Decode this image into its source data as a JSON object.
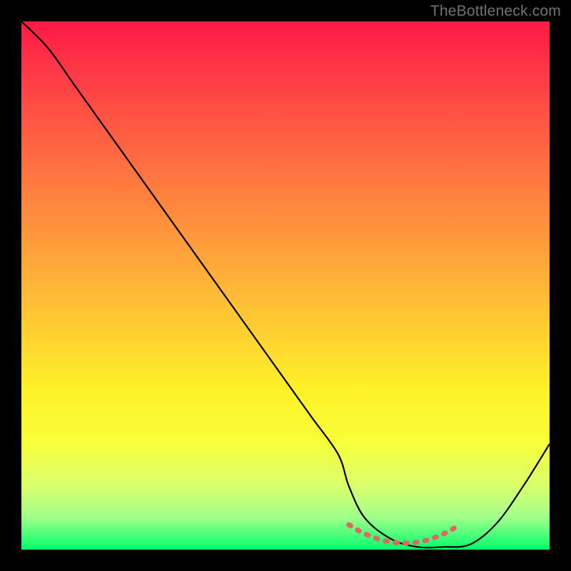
{
  "watermark": "TheBottleneck.com",
  "chart_data": {
    "type": "line",
    "title": "",
    "xlabel": "",
    "ylabel": "",
    "xlim": [
      0,
      100
    ],
    "ylim": [
      0,
      100
    ],
    "x": [
      0,
      5,
      10,
      15,
      20,
      25,
      30,
      35,
      40,
      45,
      50,
      55,
      60,
      62,
      65,
      70,
      75,
      80,
      85,
      90,
      95,
      100
    ],
    "values": [
      100,
      95,
      88,
      81,
      74,
      67,
      60,
      53,
      46,
      39,
      32,
      25,
      18,
      12,
      6,
      2,
      0.5,
      0.5,
      1,
      5,
      12,
      20
    ],
    "bottom_dash_x_range": [
      62,
      83
    ],
    "bottom_dash_y": 1.2,
    "gradient_stops": [
      {
        "pos": 0,
        "color": "#ff1845"
      },
      {
        "pos": 50,
        "color": "#ffb537"
      },
      {
        "pos": 80,
        "color": "#f7ff3a"
      },
      {
        "pos": 100,
        "color": "#00ff6a"
      }
    ]
  }
}
